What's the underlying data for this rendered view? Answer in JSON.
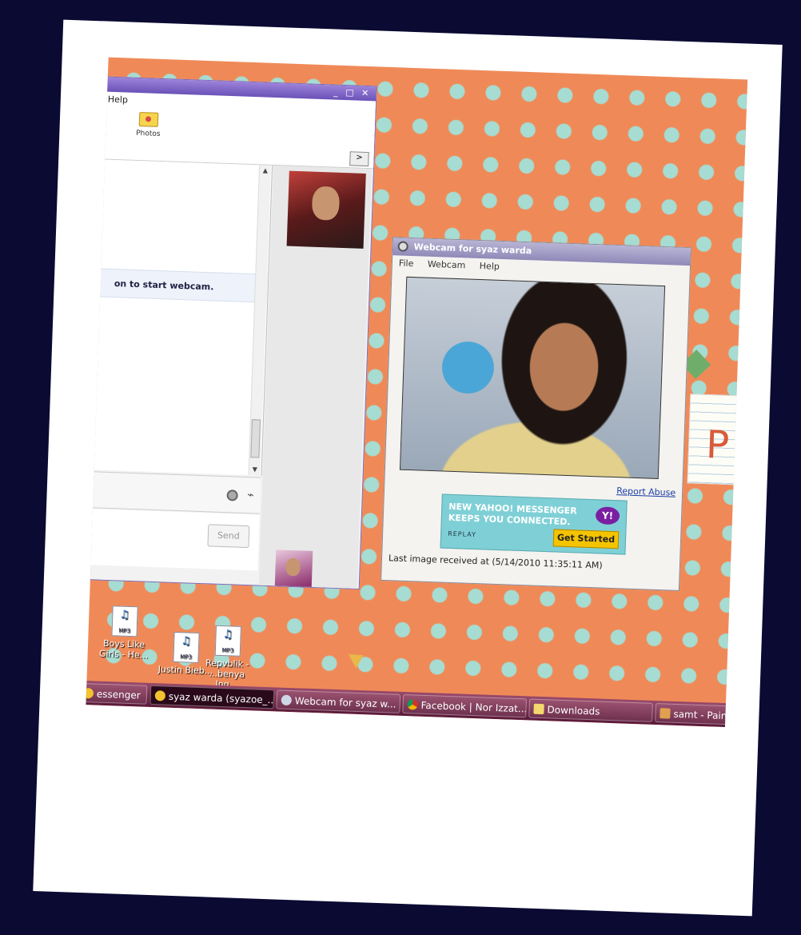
{
  "chat_window": {
    "menu_partial": "Help",
    "toolbar_photos": "Photos",
    "info_text": "on to start webcam.",
    "send_label": "Send"
  },
  "webcam_window": {
    "title": "Webcam for syaz warda",
    "menu": [
      "File",
      "Webcam",
      "Help"
    ],
    "report_abuse": "Report Abuse",
    "last_image": "Last image received at (5/14/2010 11:35:11 AM)",
    "ad": {
      "line1": "NEW YAHOO! MESSENGER",
      "line2": "KEEPS YOU CONNECTED.",
      "replay": "REPLAY",
      "logo": "Y!",
      "button": "Get Started"
    }
  },
  "desktop_icons": [
    {
      "label": "Boys Like Girls - He..."
    },
    {
      "label": "Justin Bieb..."
    },
    {
      "label": "Repvblik - ...benya Ing..."
    }
  ],
  "taskbar": {
    "items": [
      {
        "label": "essenger",
        "icon": "messenger-icon"
      },
      {
        "label": "syaz warda (syazoe_...",
        "icon": "messenger-icon"
      },
      {
        "label": "Webcam for syaz w...",
        "icon": "webcam-icon"
      },
      {
        "label": "Facebook | Nor Izzat...",
        "icon": "chrome-icon"
      },
      {
        "label": "Downloads",
        "icon": "folder-icon"
      },
      {
        "label": "samt - Pain",
        "icon": "paint-icon"
      }
    ]
  }
}
